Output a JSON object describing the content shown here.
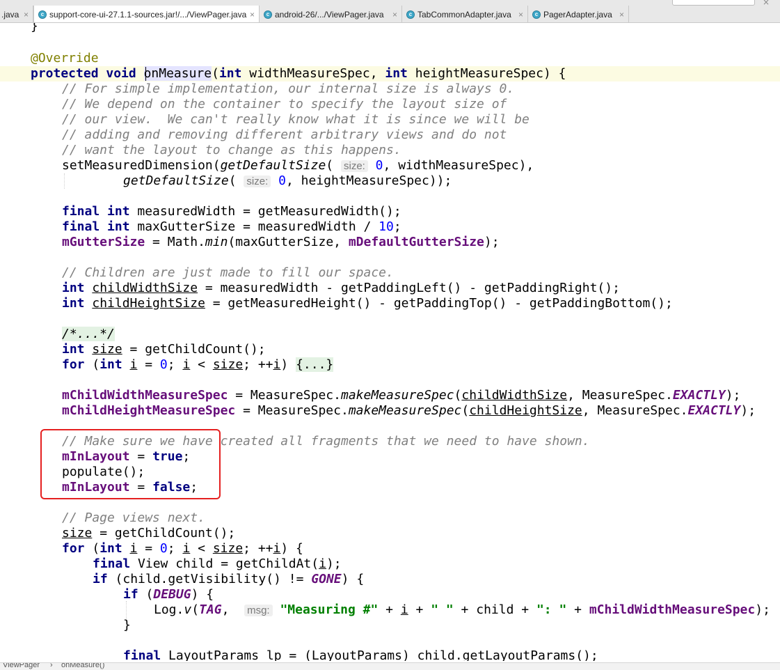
{
  "tabs": [
    {
      "label": ".java",
      "active": false
    },
    {
      "label": "support-core-ui-27.1.1-sources.jar!/.../ViewPager.java",
      "active": true
    },
    {
      "label": "android-26/.../ViewPager.java",
      "active": false
    },
    {
      "label": "TabCommonAdapter.java",
      "active": false
    },
    {
      "label": "PagerAdapter.java",
      "active": false
    }
  ],
  "tab_icon_glyph": "c",
  "tab_close_glyph": "×",
  "code": {
    "l0": "}",
    "l1": "@Override",
    "l2_kw": "protected void ",
    "l2_name": "onMeasure",
    "l2_p1": "(",
    "l2_int1": "int",
    "l2_p2": " widthMeasureSpec, ",
    "l2_int2": "int",
    "l2_p3": " heightMeasureSpec) {",
    "l3": "// For simple implementation, our internal size is always 0.",
    "l4": "// We depend on the container to specify the layout size of",
    "l5": "// our view.  We can't really know what it is since we will be",
    "l6": "// adding and removing different arbitrary views and do not",
    "l7": "// want the layout to change as this happens.",
    "l8_a": "setMeasuredDimension(",
    "l8_b": "getDefaultSize",
    "l8_c": "( ",
    "l8_hint": "size:",
    "l8_d": " ",
    "l8_num": "0",
    "l8_e": ", widthMeasureSpec),",
    "l9_b": "getDefaultSize",
    "l9_c": "( ",
    "l9_hint": "size:",
    "l9_d": " ",
    "l9_num": "0",
    "l9_e": ", heightMeasureSpec));",
    "l10_kw": "final int",
    "l10_rest": " measuredWidth = getMeasuredWidth();",
    "l11_kw": "final int",
    "l11_rest": " maxGutterSize = measuredWidth / ",
    "l11_num": "10",
    "l11_end": ";",
    "l12_f1": "mGutterSize",
    "l12_a": " = Math.",
    "l12_min": "min",
    "l12_b": "(maxGutterSize, ",
    "l12_f2": "mDefaultGutterSize",
    "l12_c": ");",
    "l13": "// Children are just made to fill our space.",
    "l14_kw": "int",
    "l14_sp": " ",
    "l14_var": "childWidthSize",
    "l14_rest": " = measuredWidth - getPaddingLeft() - getPaddingRight();",
    "l15_kw": "int",
    "l15_sp": " ",
    "l15_var": "childHeightSize",
    "l15_rest": " = getMeasuredHeight() - getPaddingTop() - getPaddingBottom();",
    "l16": "/*...*/",
    "l17_kw": "int",
    "l17_sp": " ",
    "l17_var": "size",
    "l17_rest": " = getChildCount();",
    "l18_kw": "for",
    "l18_a": " (",
    "l18_int": "int",
    "l18_b": " ",
    "l18_i1": "i",
    "l18_c": " = ",
    "l18_num": "0",
    "l18_d": "; ",
    "l18_i2": "i",
    "l18_e": " < ",
    "l18_size": "size",
    "l18_f": "; ++",
    "l18_i3": "i",
    "l18_g": ") ",
    "l18_fold": "{...}",
    "l19_f": "mChildWidthMeasureSpec",
    "l19_a": " = MeasureSpec.",
    "l19_m": "makeMeasureSpec",
    "l19_b": "(",
    "l19_var": "childWidthSize",
    "l19_c": ", MeasureSpec.",
    "l19_cst": "EXACTLY",
    "l19_d": ");",
    "l20_f": "mChildHeightMeasureSpec",
    "l20_a": " = MeasureSpec.",
    "l20_m": "makeMeasureSpec",
    "l20_b": "(",
    "l20_var": "childHeightSize",
    "l20_c": ", MeasureSpec.",
    "l20_cst": "EXACTLY",
    "l20_d": ");",
    "l21": "// Make sure we have created all fragments that we need to have shown.",
    "l22_f": "mInLayout",
    "l22_a": " = ",
    "l22_kw": "true",
    "l22_b": ";",
    "l23": "populate();",
    "l24_f": "mInLayout",
    "l24_a": " = ",
    "l24_kw": "false",
    "l24_b": ";",
    "l25": "// Page views next.",
    "l26_var": "size",
    "l26_rest": " = getChildCount();",
    "l27_kw": "for",
    "l27_a": " (",
    "l27_int": "int",
    "l27_b": " ",
    "l27_i1": "i",
    "l27_c": " = ",
    "l27_num": "0",
    "l27_d": "; ",
    "l27_i2": "i",
    "l27_e": " < ",
    "l27_size": "size",
    "l27_f": "; ++",
    "l27_i3": "i",
    "l27_g": ") {",
    "l28_kw": "final",
    "l28_a": " View child = getChildAt(",
    "l28_i": "i",
    "l28_b": ");",
    "l29_kw": "if",
    "l29_a": " (child.getVisibility() != ",
    "l29_cst": "GONE",
    "l29_b": ") {",
    "l30_kw": "if",
    "l30_a": " (",
    "l30_cst": "DEBUG",
    "l30_b": ") {",
    "l31_a": "Log.",
    "l31_v": "v",
    "l31_b": "(",
    "l31_cst": "TAG",
    "l31_c": ",  ",
    "l31_hint": "msg:",
    "l31_d": " ",
    "l31_s1": "\"Measuring #\"",
    "l31_e": " + ",
    "l31_i": "i",
    "l31_f": " + ",
    "l31_s2": "\" \"",
    "l31_g": " + child + ",
    "l31_s3": "\": \"",
    "l31_h": " + ",
    "l31_fld": "mChildWidthMeasureSpec",
    "l31_end": ");",
    "l32": "}",
    "l33_kw": "final",
    "l33_rest": " LayoutParams lp = (LayoutParams) child.getLayoutParams();"
  },
  "breadcrumb": {
    "file": "ViewPager",
    "sep": "›",
    "method": "onMeasure()"
  }
}
